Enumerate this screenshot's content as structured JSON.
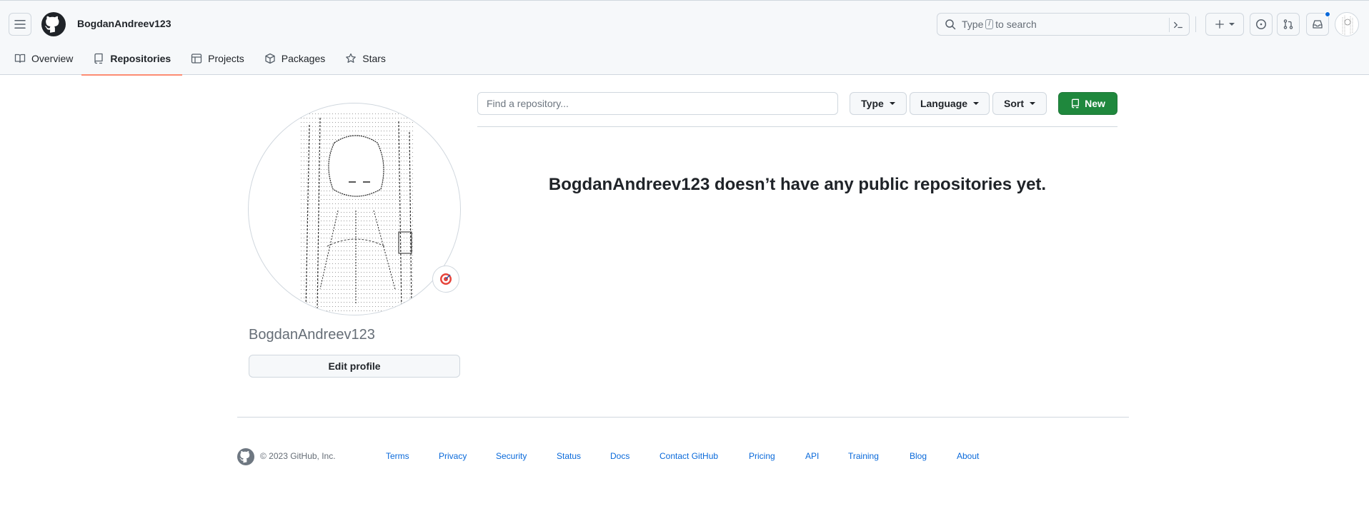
{
  "header": {
    "username": "BogdanAndreev123",
    "search": {
      "prefix": "Type",
      "key": "/",
      "suffix": "to search"
    }
  },
  "tabs": [
    {
      "label": "Overview",
      "icon": "book-icon"
    },
    {
      "label": "Repositories",
      "icon": "repo-icon",
      "active": true
    },
    {
      "label": "Projects",
      "icon": "table-icon"
    },
    {
      "label": "Packages",
      "icon": "package-icon"
    },
    {
      "label": "Stars",
      "icon": "star-icon"
    }
  ],
  "profile": {
    "name": "BogdanAndreev123",
    "edit_label": "Edit profile",
    "status_icon": "target-emoji-icon"
  },
  "repos": {
    "find_placeholder": "Find a repository...",
    "type_label": "Type",
    "language_label": "Language",
    "sort_label": "Sort",
    "new_label": "New",
    "empty_message": "BogdanAndreev123 doesn’t have any public repositories yet."
  },
  "footer": {
    "copyright": "© 2023 GitHub, Inc.",
    "links": [
      "Terms",
      "Privacy",
      "Security",
      "Status",
      "Docs",
      "Contact GitHub",
      "Pricing",
      "API",
      "Training",
      "Blog",
      "About"
    ]
  },
  "colors": {
    "accent_underline": "#fd8c73",
    "new_button": "#1f883d",
    "link": "#0969da",
    "notification_dot": "#0969da"
  }
}
